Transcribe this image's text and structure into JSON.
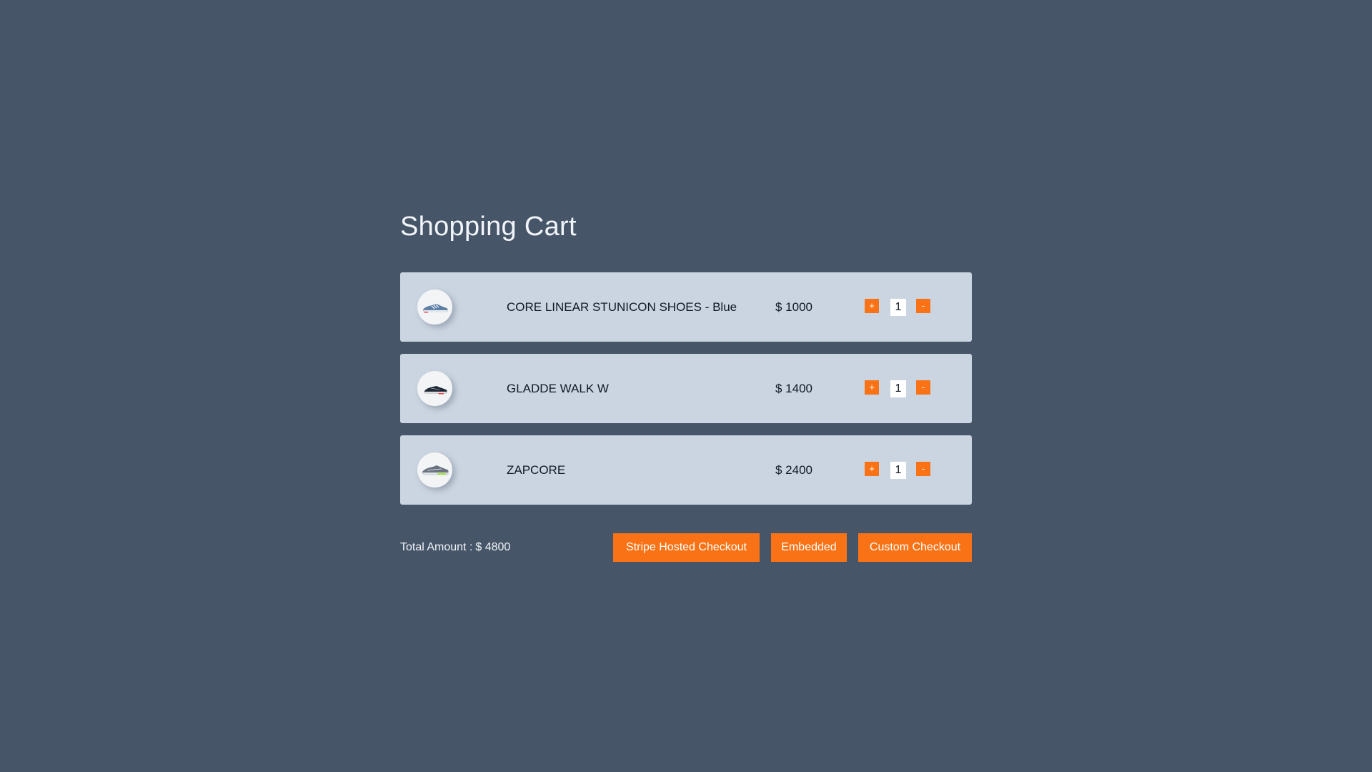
{
  "page": {
    "title": "Shopping Cart"
  },
  "cart": {
    "items": [
      {
        "name": "CORE LINEAR STUNICON SHOES - Blue",
        "price": "$ 1000",
        "quantity": "1",
        "image_icon": "blue-running-shoe-icon"
      },
      {
        "name": "GLADDE WALK W",
        "price": "$ 1400",
        "quantity": "1",
        "image_icon": "black-walking-shoe-icon"
      },
      {
        "name": "ZAPCORE",
        "price": "$ 2400",
        "quantity": "1",
        "image_icon": "grey-running-shoe-icon"
      }
    ],
    "plus_label": "+",
    "minus_label": "-"
  },
  "footer": {
    "total_label": "Total Amount :",
    "total_value": "$ 4800",
    "buttons": {
      "stripe_hosted": "Stripe Hosted Checkout",
      "embedded": "Embedded",
      "custom": "Custom Checkout"
    }
  },
  "colors": {
    "background": "#475569",
    "card": "#cbd5e1",
    "accent": "#f97316",
    "title_text": "#f1f5f9"
  }
}
